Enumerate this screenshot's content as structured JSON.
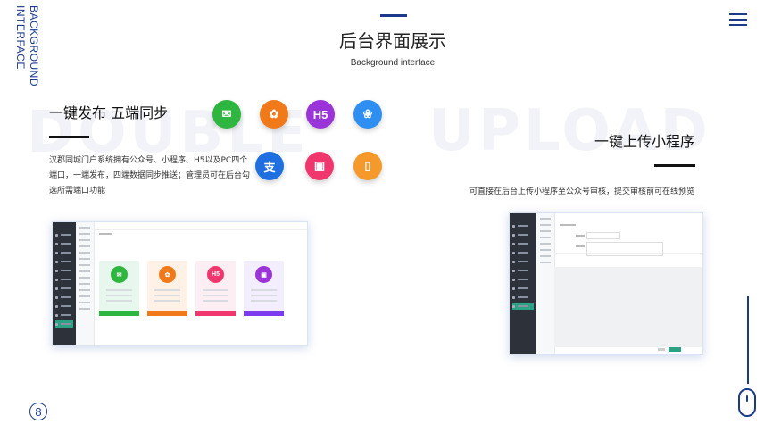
{
  "side_label": {
    "line1": "BACKGROUND",
    "line2": "INTERFACE"
  },
  "header": {
    "title": "后台界面展示",
    "subtitle": "Background interface"
  },
  "watermarks": {
    "left": "DOUBLE",
    "right": "UPLOAD"
  },
  "feature_left": {
    "title": "一键发布 五端同步",
    "description": "汉郡同城门户系统拥有公众号、小程序、H5以及PC四个端口，一端发布，四端数据同步推送；管理员可在后台勾选所需端口功能",
    "platform_icons": [
      {
        "name": "wechat-icon",
        "glyph": "✉",
        "color": "#2fb640"
      },
      {
        "name": "miniprogram-icon",
        "glyph": "✿",
        "color": "#f07a1a"
      },
      {
        "name": "h5-icon",
        "glyph": "H5",
        "color": "#9a34d9"
      },
      {
        "name": "baidu-icon",
        "glyph": "❀",
        "color": "#2e8ff0"
      },
      {
        "name": "alipay-icon",
        "glyph": "支",
        "color": "#1f6fe0"
      },
      {
        "name": "pc-icon",
        "glyph": "▣",
        "color": "#f0376d"
      },
      {
        "name": "mobile-icon",
        "glyph": "▯",
        "color": "#f59a2a"
      }
    ]
  },
  "feature_right": {
    "title": "一键上传小程序",
    "description": "可直接在后台上传小程序至公众号审核，提交审核前可在线预览"
  },
  "mock_left": {
    "cards": [
      {
        "color": "#e8f7ee",
        "icon_color": "#2fb640",
        "btn": "#2fb640",
        "glyph": "✉"
      },
      {
        "color": "#fff1e6",
        "icon_color": "#f07a1a",
        "btn": "#f07a1a",
        "glyph": "✿"
      },
      {
        "color": "#fdeef3",
        "icon_color": "#f0376d",
        "btn": "#f0376d",
        "glyph": "H5"
      },
      {
        "color": "#f3eefd",
        "icon_color": "#9a34d9",
        "btn": "#7b3cf0",
        "glyph": "▣"
      }
    ]
  },
  "page_number": "8"
}
